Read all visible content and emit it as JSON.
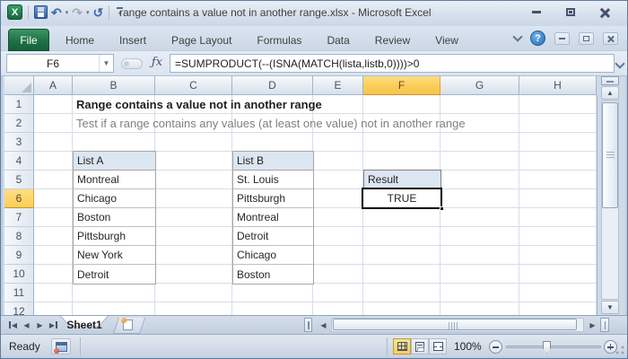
{
  "window": {
    "title": "range contains a value not in another range.xlsx - Microsoft Excel"
  },
  "ribbon": {
    "file_tab": "File",
    "tabs": [
      "Home",
      "Insert",
      "Page Layout",
      "Formulas",
      "Data",
      "Review",
      "View"
    ]
  },
  "formula_bar": {
    "name_box": "F6",
    "fx_label": "ƒx",
    "formula": "=SUMPRODUCT(--(ISNA(MATCH(lista,listb,0))))>0"
  },
  "grid": {
    "columns": [
      "A",
      "B",
      "C",
      "D",
      "E",
      "F",
      "G",
      "H"
    ],
    "rows": [
      "1",
      "2",
      "3",
      "4",
      "5",
      "6",
      "7",
      "8",
      "9",
      "10",
      "11",
      "12"
    ],
    "selected_cell": "F6",
    "selected_column": "F",
    "selected_row": "6"
  },
  "sheet": {
    "title": "Range contains a value not in another range",
    "subtitle": "Test if a range contains any values (at least one value) not in another range",
    "list_a": {
      "header": "List A",
      "values": [
        "Montreal",
        "Chicago",
        "Boston",
        "Pittsburgh",
        "New York",
        "Detroit"
      ]
    },
    "list_b": {
      "header": "List B",
      "values": [
        "St. Louis",
        "Pittsburgh",
        "Montreal",
        "Detroit",
        "Chicago",
        "Boston"
      ]
    },
    "result": {
      "header": "Result",
      "value": "TRUE"
    }
  },
  "sheet_bar": {
    "tab": "Sheet1"
  },
  "status_bar": {
    "ready": "Ready",
    "zoom": "100%"
  },
  "colors": {
    "selection_accent": "#F8CE52",
    "table_header_fill": "#DCE6F1",
    "file_tab_green": "#1E7145",
    "help_blue": "#2F76BF",
    "selection_border": "#000000"
  }
}
